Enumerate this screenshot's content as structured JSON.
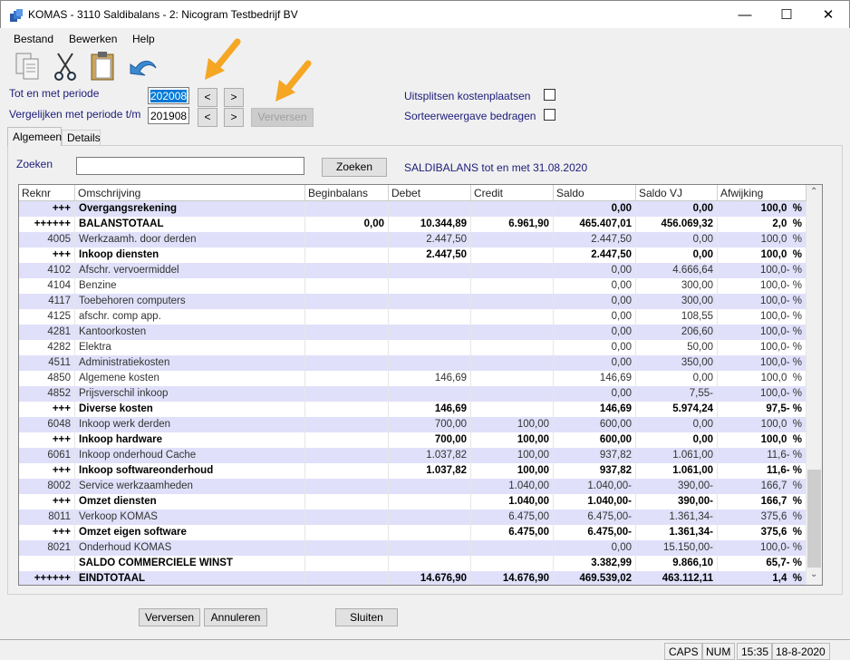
{
  "window": {
    "title": "KOMAS - 3110 Saldibalans - 2: Nicogram Testbedrijf BV"
  },
  "menu": [
    "Bestand",
    "Bewerken",
    "Help"
  ],
  "form": {
    "period_label": "Tot en met periode",
    "period_value": "202008",
    "compare_label": "Vergelijken met periode t/m",
    "compare_value": "201908",
    "prev": "<",
    "next": ">",
    "refresh": "Verversen",
    "split_label": "Uitsplitsen kostenplaatsen",
    "split_checked": false,
    "sort_label": "Sorteerweergave bedragen",
    "sort_checked": false
  },
  "tabs": [
    "Algemeen",
    "Details"
  ],
  "search": {
    "label": "Zoeken",
    "value": "",
    "button": "Zoeken",
    "caption": "SALDIBALANS tot en met 31.08.2020"
  },
  "table": {
    "columns": [
      "Reknr",
      "Omschrijving",
      "Beginbalans",
      "Debet",
      "Credit",
      "Saldo",
      "Saldo VJ",
      "Afwijking"
    ],
    "rows": [
      [
        "+++",
        "Overgangsrekening",
        "",
        "",
        "",
        "0,00",
        "0,00",
        "100,0  %",
        true
      ],
      [
        "++++++",
        "BALANSTOTAAL",
        "0,00",
        "10.344,89",
        "6.961,90",
        "465.407,01",
        "456.069,32",
        "2,0  %",
        true
      ],
      [
        "4005",
        "Werkzaamh. door derden",
        "",
        "2.447,50",
        "",
        "2.447,50",
        "0,00",
        "100,0  %",
        false
      ],
      [
        "+++",
        "Inkoop diensten",
        "",
        "2.447,50",
        "",
        "2.447,50",
        "0,00",
        "100,0  %",
        true
      ],
      [
        "4102",
        "Afschr. vervoermiddel",
        "",
        "",
        "",
        "0,00",
        "4.666,64",
        "100,0- %",
        false
      ],
      [
        "4104",
        "Benzine",
        "",
        "",
        "",
        "0,00",
        "300,00",
        "100,0- %",
        false
      ],
      [
        "4117",
        "Toebehoren computers",
        "",
        "",
        "",
        "0,00",
        "300,00",
        "100,0- %",
        false
      ],
      [
        "4125",
        "afschr. comp app.",
        "",
        "",
        "",
        "0,00",
        "108,55",
        "100,0- %",
        false
      ],
      [
        "4281",
        "Kantoorkosten",
        "",
        "",
        "",
        "0,00",
        "206,60",
        "100,0- %",
        false
      ],
      [
        "4282",
        "Elektra",
        "",
        "",
        "",
        "0,00",
        "50,00",
        "100,0- %",
        false
      ],
      [
        "4511",
        "Administratiekosten",
        "",
        "",
        "",
        "0,00",
        "350,00",
        "100,0- %",
        false
      ],
      [
        "4850",
        "Algemene kosten",
        "",
        "146,69",
        "",
        "146,69",
        "0,00",
        "100,0  %",
        false
      ],
      [
        "4852",
        "Prijsverschil inkoop",
        "",
        "",
        "",
        "0,00",
        "7,55-",
        "100,0- %",
        false
      ],
      [
        "+++",
        "Diverse kosten",
        "",
        "146,69",
        "",
        "146,69",
        "5.974,24",
        "97,5- %",
        true
      ],
      [
        "6048",
        "Inkoop werk derden",
        "",
        "700,00",
        "100,00",
        "600,00",
        "0,00",
        "100,0  %",
        false
      ],
      [
        "+++",
        "Inkoop hardware",
        "",
        "700,00",
        "100,00",
        "600,00",
        "0,00",
        "100,0  %",
        true
      ],
      [
        "6061",
        "Inkoop onderhoud Cache",
        "",
        "1.037,82",
        "100,00",
        "937,82",
        "1.061,00",
        "11,6- %",
        false
      ],
      [
        "+++",
        "Inkoop softwareonderhoud",
        "",
        "1.037,82",
        "100,00",
        "937,82",
        "1.061,00",
        "11,6- %",
        true
      ],
      [
        "8002",
        "Service werkzaamheden",
        "",
        "",
        "1.040,00",
        "1.040,00-",
        "390,00-",
        "166,7  %",
        false
      ],
      [
        "+++",
        "Omzet diensten",
        "",
        "",
        "1.040,00",
        "1.040,00-",
        "390,00-",
        "166,7  %",
        true
      ],
      [
        "8011",
        "Verkoop KOMAS",
        "",
        "",
        "6.475,00",
        "6.475,00-",
        "1.361,34-",
        "375,6  %",
        false
      ],
      [
        "+++",
        "Omzet eigen software",
        "",
        "",
        "6.475,00",
        "6.475,00-",
        "1.361,34-",
        "375,6  %",
        true
      ],
      [
        "8021",
        "Onderhoud KOMAS",
        "",
        "",
        "",
        "0,00",
        "15.150,00-",
        "100,0- %",
        false
      ],
      [
        "",
        "SALDO COMMERCIELE WINST",
        "",
        "",
        "",
        "3.382,99",
        "9.866,10",
        "65,7- %",
        true
      ],
      [
        "++++++",
        "EINDTOTAAL",
        "",
        "14.676,90",
        "14.676,90",
        "469.539,02",
        "463.112,11",
        "1,4  %",
        true
      ]
    ]
  },
  "buttons": {
    "refresh": "Verversen",
    "cancel": "Annuleren",
    "close": "Sluiten"
  },
  "status": {
    "caps": "CAPS",
    "num": "NUM",
    "time": "15:35",
    "date": "18-8-2020"
  },
  "colors": {
    "row_alt": "#e0e0fa",
    "label": "#1c1c7a",
    "arrow": "#f5a623"
  }
}
